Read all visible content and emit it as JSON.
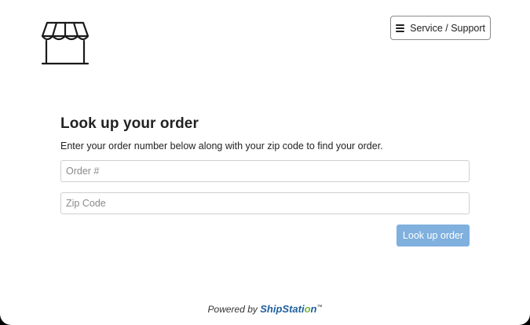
{
  "header": {
    "logo_icon": "storefront-icon",
    "support_button": {
      "icon": "hamburger-icon",
      "label": "Service / Support"
    }
  },
  "main": {
    "title": "Look up your order",
    "subtitle": "Enter your order number below along with your zip code to find your order.",
    "order_input": {
      "placeholder": "Order #",
      "value": ""
    },
    "zip_input": {
      "placeholder": "Zip Code",
      "value": ""
    },
    "submit_label": "Look up order"
  },
  "footer": {
    "powered_by": "Powered by",
    "brand_prefix": "ShipStati",
    "brand_accent": "o",
    "brand_suffix": "n",
    "trademark": "™"
  },
  "colors": {
    "button_bg": "#7fb0de",
    "brand_blue": "#1f5f9f",
    "brand_green": "#6fb83f",
    "text": "#222222"
  }
}
